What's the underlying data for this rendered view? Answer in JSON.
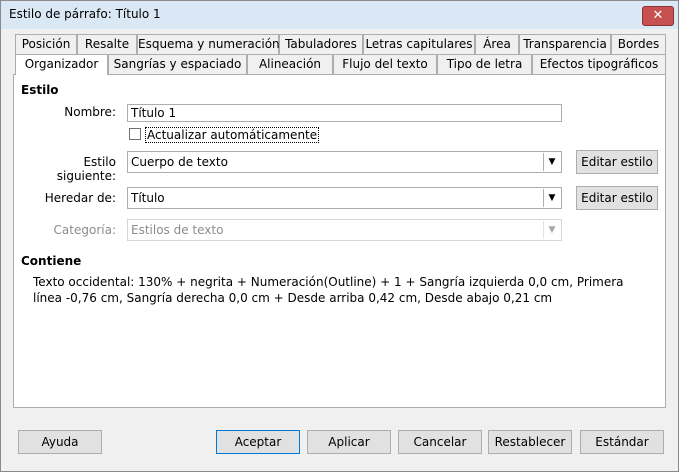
{
  "window": {
    "title": "Estilo de párrafo: Título 1",
    "close_glyph": "✕"
  },
  "tabs_row1": [
    "Posición",
    "Resalte",
    "Esquema y numeración",
    "Tabuladores",
    "Letras capitulares",
    "Área",
    "Transparencia",
    "Bordes"
  ],
  "tabs_row2": [
    "Organizador",
    "Sangrías y espaciado",
    "Alineación",
    "Flujo del texto",
    "Tipo de letra",
    "Efectos tipográficos"
  ],
  "active_tab": "Organizador",
  "style_section": {
    "heading": "Estilo",
    "name_label": "Nombre:",
    "name_value": "Título 1",
    "autoupdate_label": "Actualizar automáticamente",
    "autoupdate_checked": false,
    "next_style_label": "Estilo siguiente:",
    "next_style_value": "Cuerpo de texto",
    "inherit_label": "Heredar de:",
    "inherit_value": "Título",
    "category_label": "Categoría:",
    "category_value": "Estilos de texto",
    "edit_style_label": "Editar estilo",
    "dropdown_glyph": "▼"
  },
  "contains_section": {
    "heading": "Contiene",
    "text": "Texto occidental: 130% + negrita + Numeración(Outline) + 1 + Sangría izquierda 0,0 cm, Primera línea -0,76 cm, Sangría derecha 0,0 cm + Desde arriba 0,42 cm, Desde abajo 0,21 cm"
  },
  "buttons": {
    "help": "Ayuda",
    "ok": "Aceptar",
    "apply": "Aplicar",
    "cancel": "Cancelar",
    "reset": "Restablecer",
    "standard": "Estándar"
  }
}
